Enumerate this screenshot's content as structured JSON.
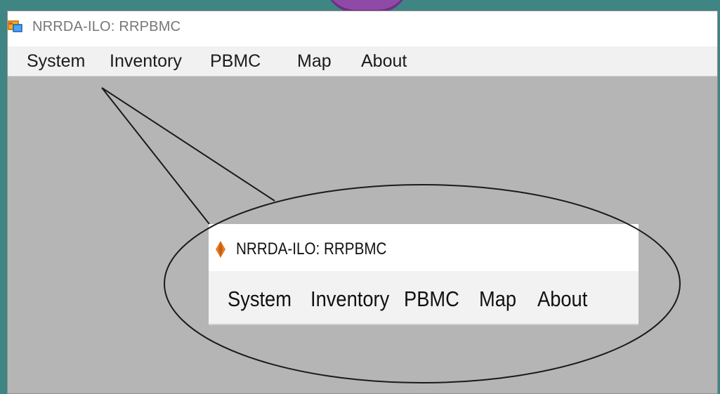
{
  "window": {
    "title": "NRRDA-ILO: RRPBMC",
    "icon": "app-window-icon"
  },
  "menu": {
    "items": [
      {
        "label": "System"
      },
      {
        "label": "Inventory"
      },
      {
        "label": "PBMC"
      },
      {
        "label": "Map"
      },
      {
        "label": "About"
      }
    ]
  },
  "zoomed_callout": {
    "title": "NRRDA-ILO: RRPBMC",
    "icon": "orange-diamond-icon",
    "items": [
      {
        "label": "System"
      },
      {
        "label": "Inventory"
      },
      {
        "label": "PBMC"
      },
      {
        "label": "Map"
      },
      {
        "label": "About"
      }
    ]
  },
  "colors": {
    "client_area": "#b5b5b5",
    "titlebar": "#ffffff",
    "menubar": "#f1f1f1",
    "accent_purple": "#8e4aa6",
    "zoom_icon": "#e67e22"
  }
}
